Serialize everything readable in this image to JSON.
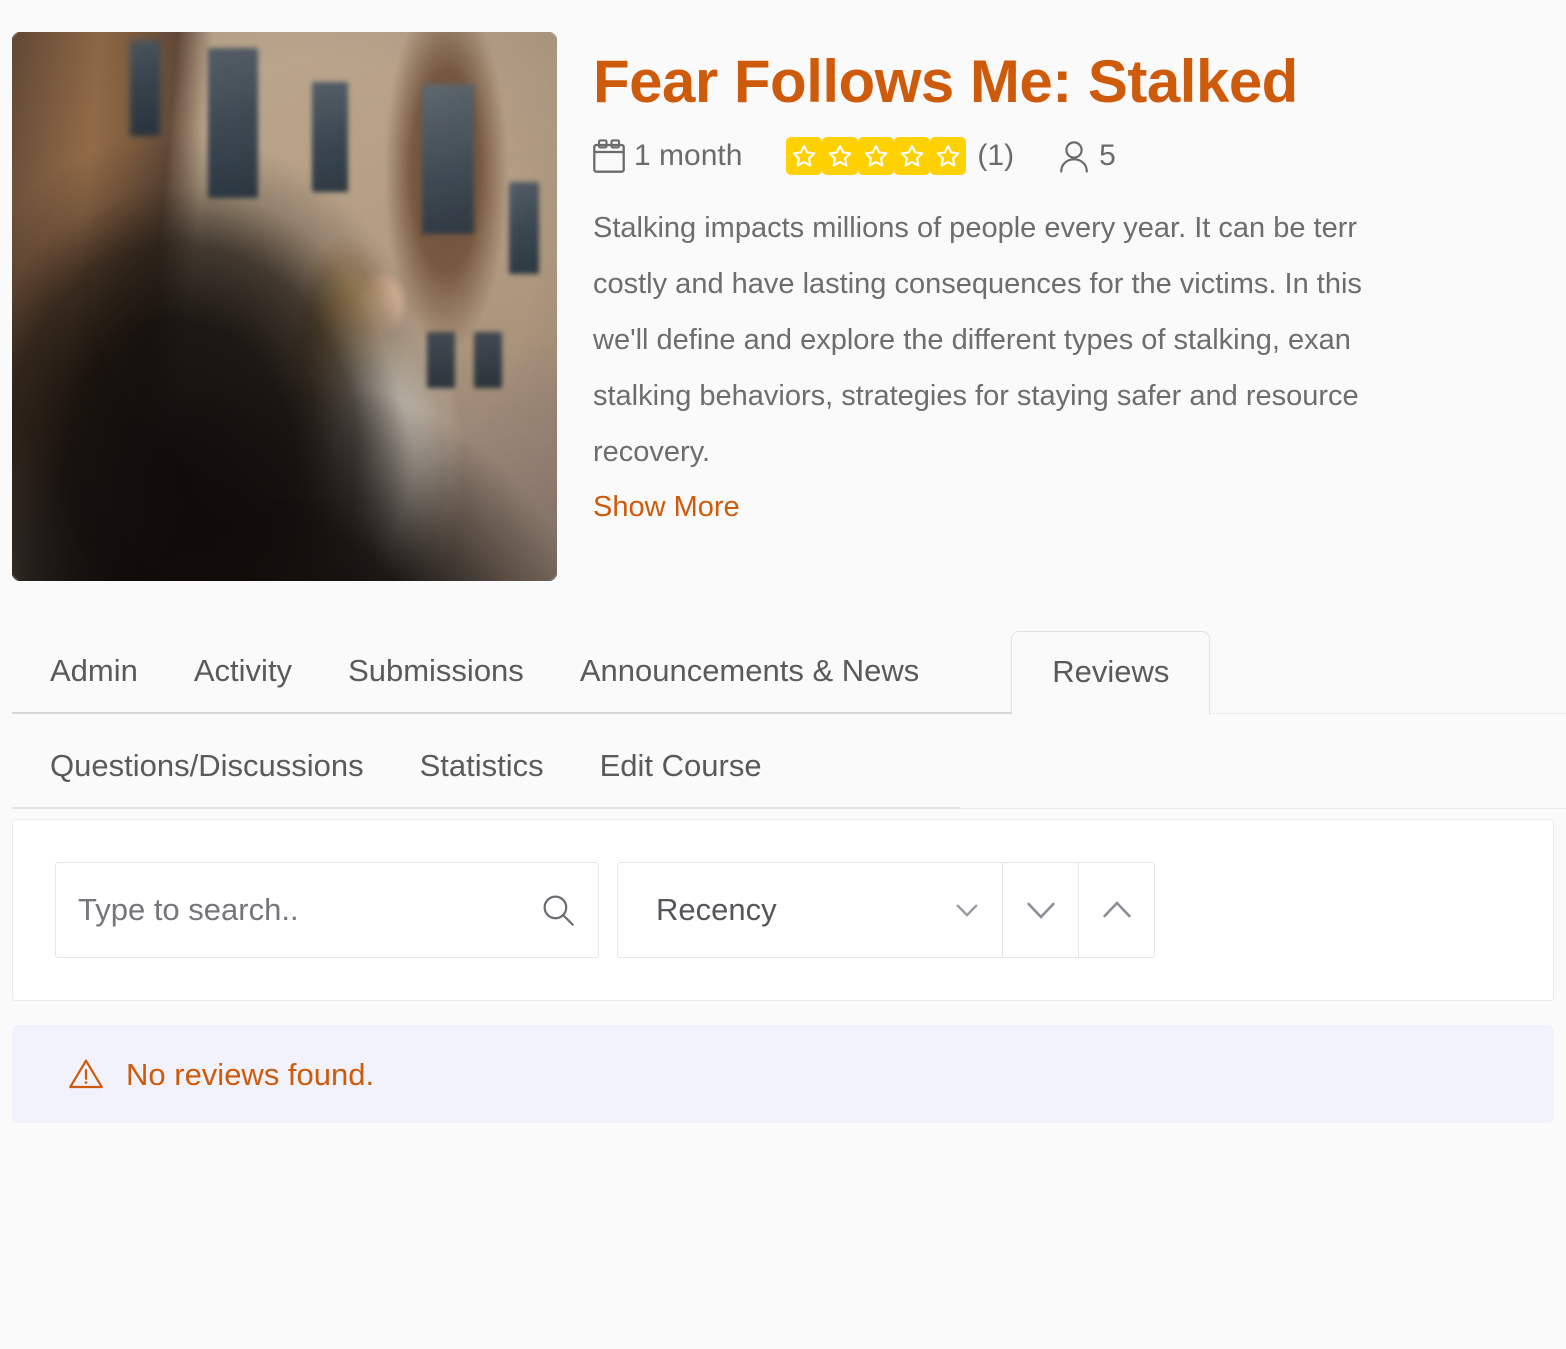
{
  "course": {
    "title": "Fear Follows Me: Stalked",
    "duration_icon": "calendar-icon",
    "duration": "1 month",
    "rating_stars": 5,
    "rating_count": "(1)",
    "enrolled_icon": "person-icon",
    "enrolled_count": "5",
    "description_lines": [
      "Stalking impacts millions of people every year. It can be terr",
      "costly and have lasting consequences for the victims. In this",
      "we'll define and explore the different types of stalking, exan",
      "stalking behaviors, strategies for staying safer and resource",
      "recovery."
    ],
    "show_more_label": "Show More",
    "thumbnail_alt": "Woman in white coat looking back over her shoulder in an alley"
  },
  "tabs": {
    "row1": [
      {
        "label": "Admin",
        "active": false
      },
      {
        "label": "Activity",
        "active": false
      },
      {
        "label": "Submissions",
        "active": false
      },
      {
        "label": "Announcements & News",
        "active": false
      },
      {
        "label": "Reviews",
        "active": true
      }
    ],
    "row2": [
      {
        "label": "Questions/Discussions",
        "active": false
      },
      {
        "label": "Statistics",
        "active": false
      },
      {
        "label": "Edit Course",
        "active": false
      }
    ]
  },
  "filters": {
    "search_placeholder": "Type to search..",
    "search_value": "",
    "search_icon": "search-icon",
    "sort_label": "Recency",
    "sort_chevron_icon": "chevron-down-icon",
    "sort_desc_icon": "chevron-down-icon",
    "sort_asc_icon": "chevron-up-icon"
  },
  "alert": {
    "icon": "warning-triangle-icon",
    "message": "No reviews found."
  },
  "colors": {
    "accent_orange": "#ce5a0b",
    "star_yellow": "#ffd100",
    "alert_background": "#f2f2fc",
    "page_background": "#fafafa",
    "text_gray": "#5a5a5a"
  }
}
